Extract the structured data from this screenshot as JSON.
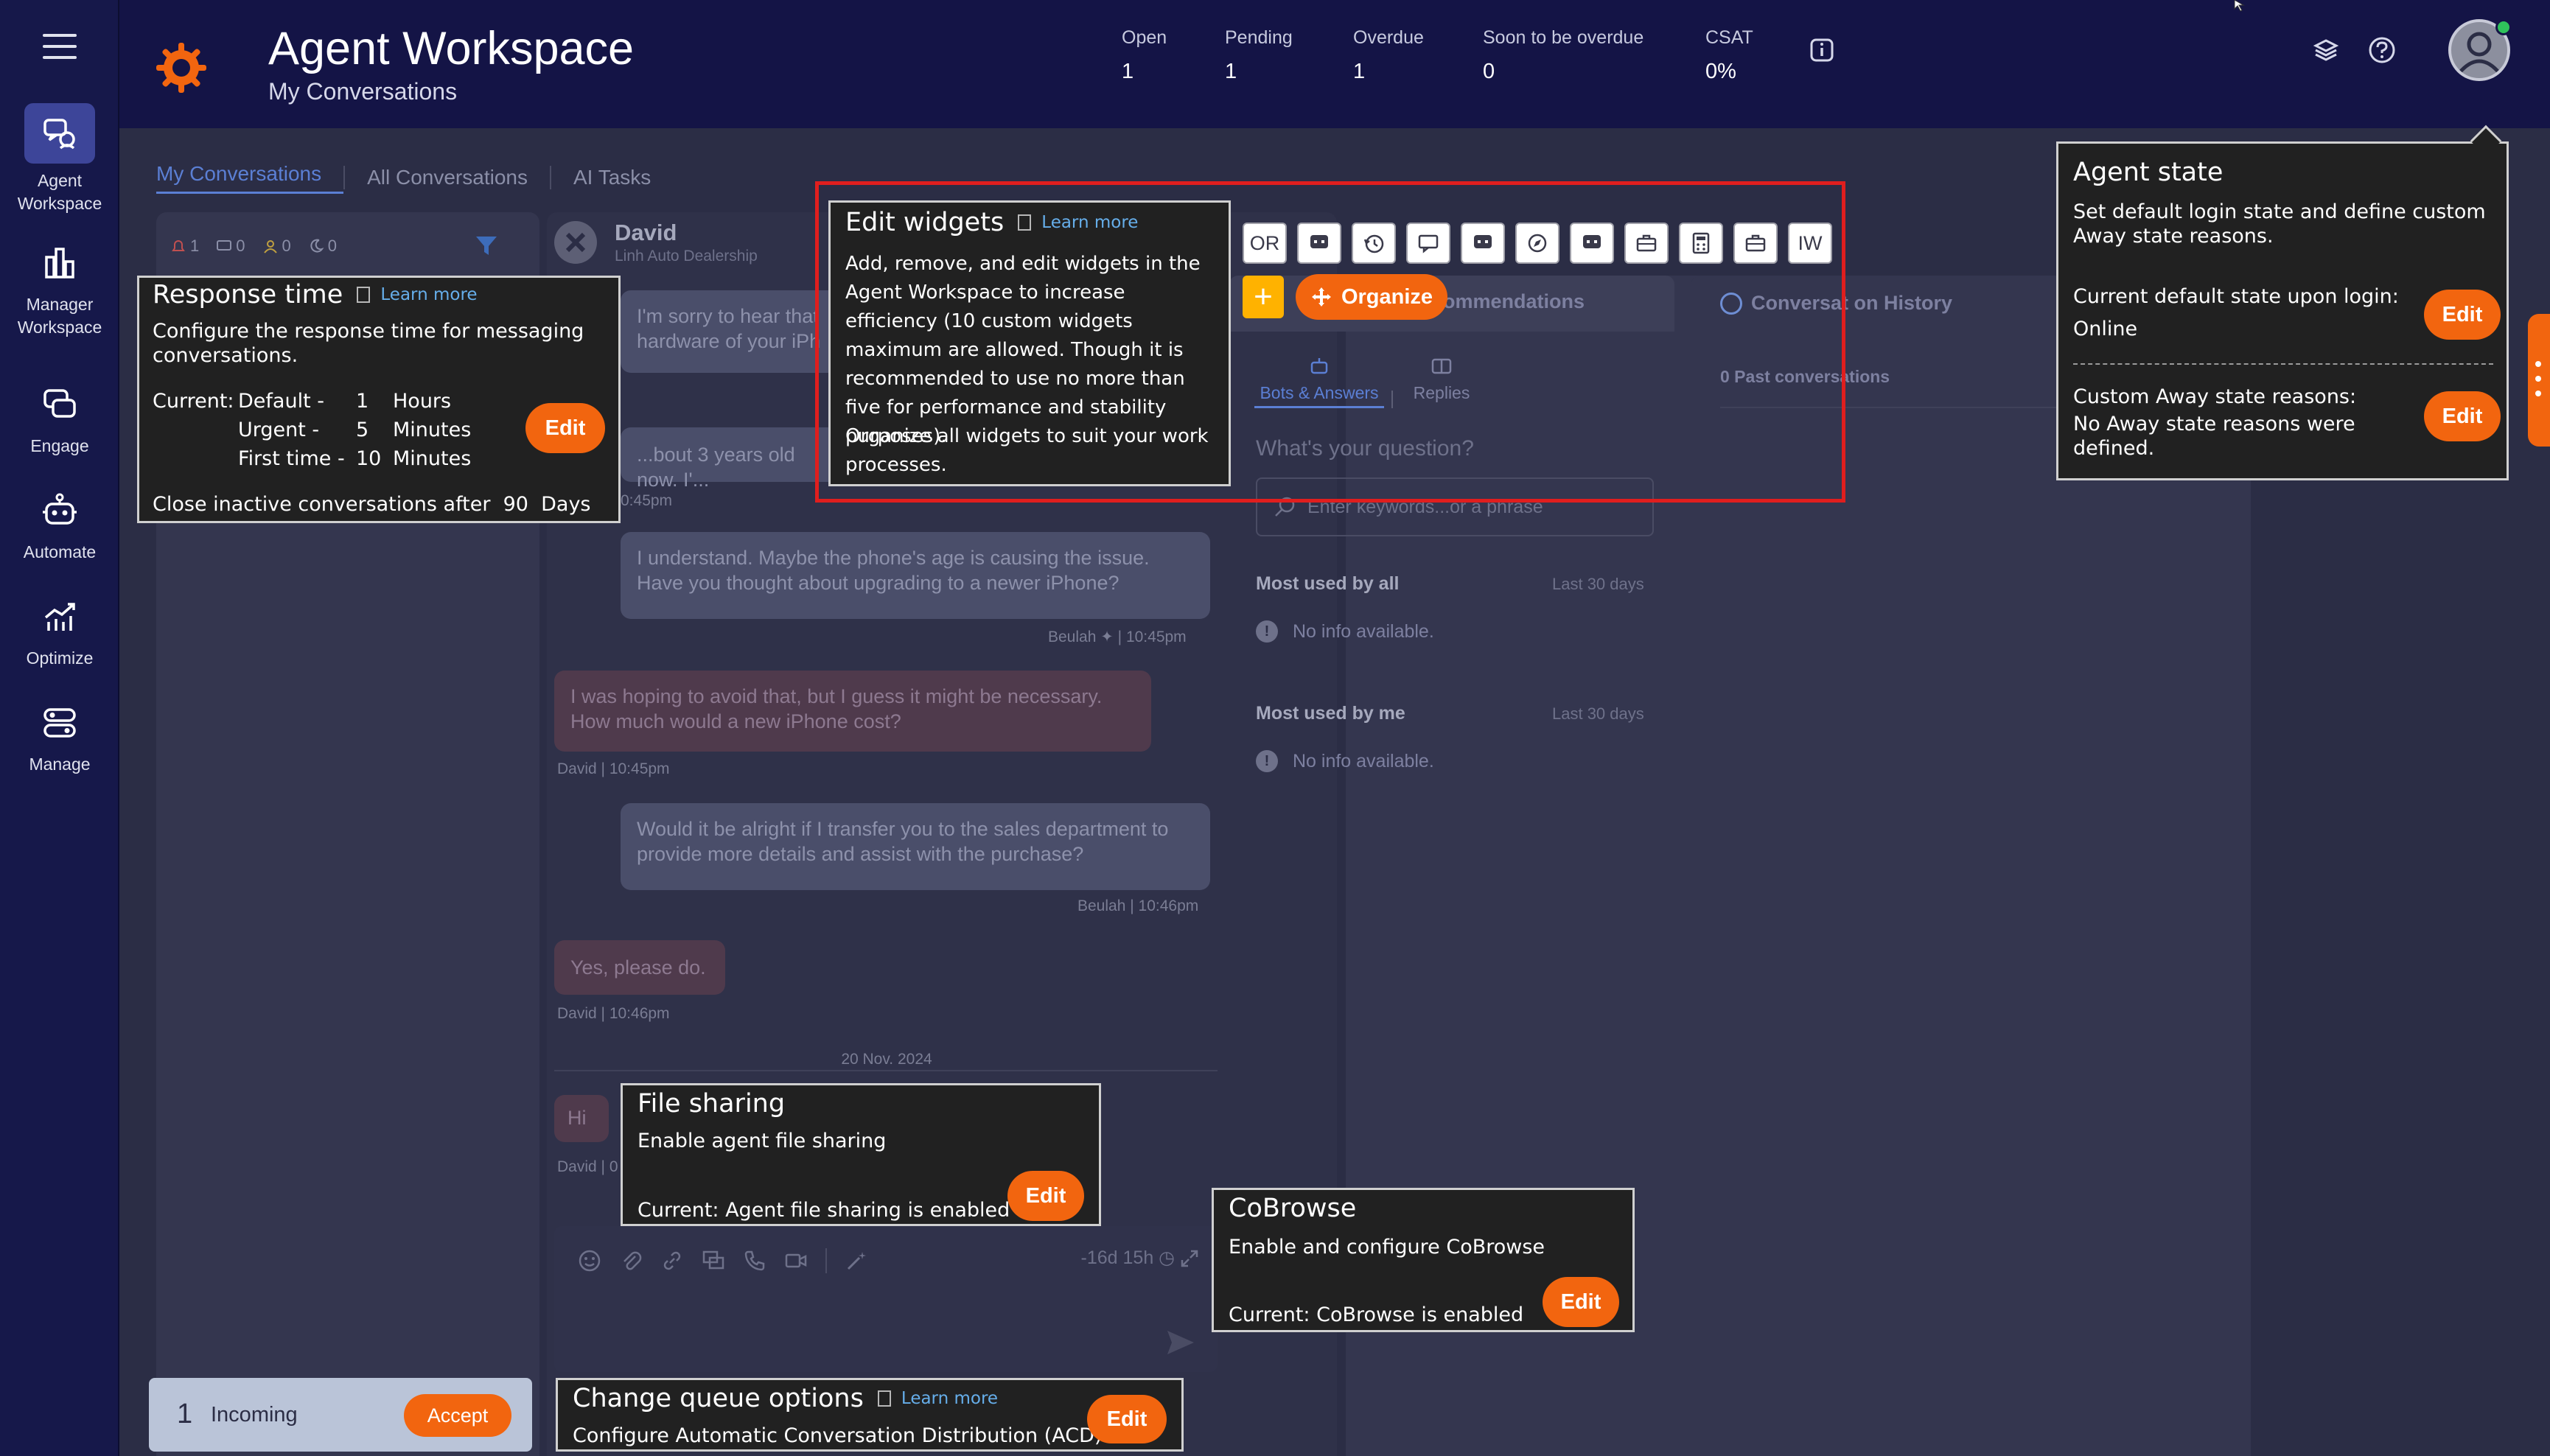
{
  "nav": {
    "items": [
      {
        "label": "Agent\nWorkspace",
        "icon": "agent-workspace-icon"
      },
      {
        "label": "Manager\nWorkspace",
        "icon": "manager-workspace-icon"
      },
      {
        "label": "Engage",
        "icon": "engage-icon"
      },
      {
        "label": "Automate",
        "icon": "automate-icon"
      },
      {
        "label": "Optimize",
        "icon": "optimize-icon"
      },
      {
        "label": "Manage",
        "icon": "manage-icon"
      }
    ]
  },
  "header": {
    "title": "Agent Workspace",
    "subtitle": "My Conversations",
    "stats": [
      {
        "label": "Open",
        "value": "1"
      },
      {
        "label": "Pending",
        "value": "1"
      },
      {
        "label": "Overdue",
        "value": "1"
      },
      {
        "label": "Soon to be overdue",
        "value": "0"
      },
      {
        "label": "CSAT",
        "value": "0%"
      }
    ],
    "colors": {
      "bar": "#141446",
      "accent": "#f2650f",
      "status_online": "#2fc25b"
    }
  },
  "tabs": [
    "My Conversations",
    "All Conversations",
    "AI Tasks"
  ],
  "filters": {
    "alerts": "1",
    "messages": "0",
    "users": "0",
    "snoozed": "0"
  },
  "conversation": {
    "name": "David",
    "company": "Linh Auto Dealership",
    "messages": [
      {
        "text": "I'm sorry to hear that ... hardware of your iPh...",
        "line1": "I'm sorry to hear that",
        "line2": "hardware of your iPh"
      },
      {
        "line1": "...bout 3 years old now. I'..."
      },
      {
        "meta": "0:45pm"
      },
      {
        "line1": "I understand. Maybe the phone's age is causing the issue.",
        "line2": "Have you thought about upgrading to a newer iPhone?",
        "meta_name": "Beulah",
        "meta_time": "10:45pm"
      },
      {
        "line1": "I was hoping to avoid that, but I guess it might be necessary.",
        "line2": "How much would a new iPhone cost?",
        "meta_name": "David",
        "meta_time": "10:45pm"
      },
      {
        "line1": "Would it be alright if I transfer you to the sales department to",
        "line2": "provide more details and assist with the purchase?",
        "meta_name": "Beulah",
        "meta_time": "10:46pm"
      },
      {
        "line1": "Yes, please do.",
        "meta_name": "David",
        "meta_time": "10:46pm"
      }
    ],
    "date_separator": "20 Nov. 2024",
    "last_message": "Hi",
    "last_meta": "David | 0",
    "composer_time": "-16d 15h"
  },
  "widgets": {
    "recommendations_title": "ommendations",
    "history_title": "Conversat on History",
    "bots_tab": "Bots & Answers",
    "replies_tab": "Replies",
    "question_placeholder": "What's your question?",
    "search_placeholder": "Enter keywords...or a phrase",
    "most_used_all": "Most used by all",
    "most_used_me": "Most used by me",
    "last_30": "Last 30 days",
    "no_info": "No info available.",
    "past_conversations": "0 Past conversations",
    "toolbar": [
      "OR",
      "",
      "",
      "",
      "",
      "",
      "",
      "",
      "",
      "",
      "IW"
    ],
    "organize_label": "Organize"
  },
  "popups": {
    "response_time": {
      "title": "Response time",
      "learn_more": "Learn more",
      "desc": "Configure the response time for messaging conversations.",
      "current_label": "Current:",
      "rows": [
        {
          "name": "Default -",
          "value": "1",
          "unit": "Hours"
        },
        {
          "name": "Urgent -",
          "value": "5",
          "unit": "Minutes"
        },
        {
          "name": "First time -",
          "value": "10",
          "unit": "Minutes"
        }
      ],
      "close_line": "Close inactive conversations after  90  Days",
      "edit": "Edit"
    },
    "edit_widgets": {
      "title": "Edit widgets",
      "learn_more": "Learn more",
      "desc": "Add, remove, and edit widgets in the Agent Workspace to increase efficiency (10 custom widgets maximum are allowed. Though it is recommended to use no more than five for performance and stability purposes).",
      "desc2": "Organize all widgets to suit your work processes."
    },
    "agent_state": {
      "title": "Agent state",
      "desc": "Set default login state and define custom Away state reasons.",
      "default_label": "Current default state upon login:",
      "default_value": "Online",
      "away_label": "Custom Away state reasons:",
      "away_value": "No Away state reasons were defined.",
      "edit": "Edit"
    },
    "file_sharing": {
      "title": "File sharing",
      "desc": "Enable agent file sharing",
      "current": "Current: Agent file sharing is enabled",
      "edit": "Edit"
    },
    "cobrowse": {
      "title": "CoBrowse",
      "desc": "Enable and configure CoBrowse",
      "current": "Current: CoBrowse is enabled",
      "edit": "Edit"
    },
    "queue": {
      "title": "Change queue options",
      "learn_more": "Learn more",
      "desc": "Configure Automatic Conversation Distribution (ACD).",
      "edit": "Edit"
    }
  },
  "incoming": {
    "count": "1",
    "label": "Incoming",
    "accept": "Accept"
  }
}
